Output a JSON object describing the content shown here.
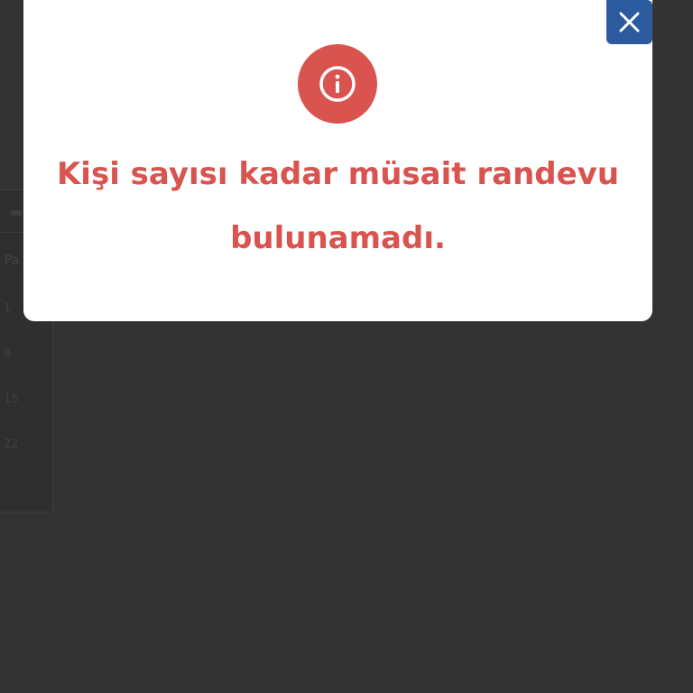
{
  "modal": {
    "message": "Kişi sayısı kadar müsait randevu bulunamadı.",
    "icon": "info-circle-icon",
    "close_icon": "close-icon"
  },
  "background": {
    "weekday_label": "Pa",
    "day_numbers": [
      "1",
      "8",
      "15",
      "22"
    ]
  },
  "colors": {
    "overlay": "#333333",
    "error_red": "#d9534f",
    "close_blue": "#2b5a9e",
    "modal_bg": "#ffffff"
  }
}
